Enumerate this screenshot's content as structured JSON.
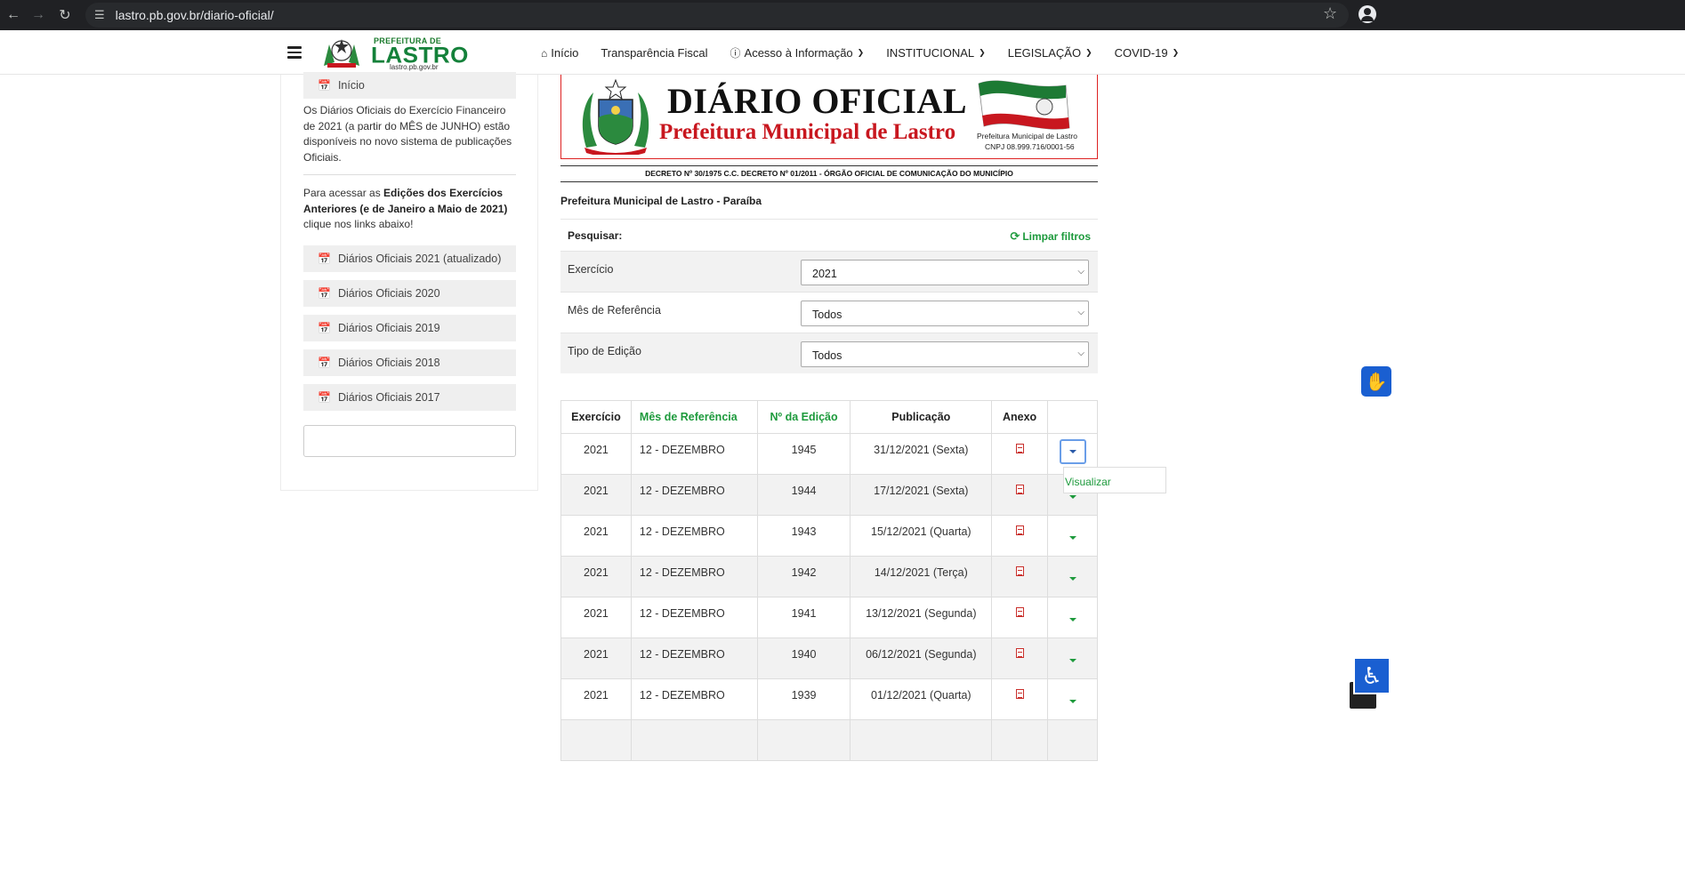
{
  "browser": {
    "url": "lastro.pb.gov.br/diario-oficial/"
  },
  "header": {
    "logo_prefix": "PREFEITURA DE",
    "logo_name": "LASTRO",
    "logo_url": "lastro.pb.gov.br",
    "nav": [
      {
        "label": "Início",
        "icon": "home-icon",
        "has_dropdown": false
      },
      {
        "label": "Transparência Fiscal",
        "icon": "",
        "has_dropdown": false
      },
      {
        "label": "Acesso à Informação",
        "icon": "info-icon",
        "has_dropdown": true
      },
      {
        "label": "INSTITUCIONAL",
        "icon": "",
        "has_dropdown": true
      },
      {
        "label": "LEGISLAÇÃO",
        "icon": "",
        "has_dropdown": true
      },
      {
        "label": "COVID-19",
        "icon": "",
        "has_dropdown": true
      }
    ]
  },
  "sidebar": {
    "home_button": "Início",
    "intro_text": "Os Diários Oficiais do Exercício Financeiro de 2021 (a partir do MÊS de JUNHO) estão disponíveis no novo sistema de publicações Oficiais.",
    "access_prefix": "Para acessar as ",
    "access_bold": "Edições dos Exercícios Anteriores (e de Janeiro a Maio de 2021)",
    "access_suffix": " clique nos links abaixo!",
    "links": [
      "Diários Oficiais 2021 (atualizado)",
      "Diários Oficiais 2020",
      "Diários Oficiais 2019",
      "Diários Oficiais 2018",
      "Diários Oficiais 2017"
    ]
  },
  "banner": {
    "title": "DIÁRIO OFICIAL",
    "subtitle": "Prefeitura Municipal de Lastro",
    "flag_caption": "Prefeitura Municipal de Lastro",
    "cnpj": "CNPJ 08.999.716/0001-56",
    "decree": "DECRETO Nº 30/1975 C.C. DECRETO Nº 01/2011 - ÓRGÃO OFICIAL DE COMUNICAÇÃO DO MUNICÍPIO"
  },
  "main": {
    "gov_name": "Prefeitura Municipal de Lastro - Paraíba",
    "search_label": "Pesquisar:",
    "clear_filters": "Limpar filtros",
    "filters": [
      {
        "label": "Exercício",
        "value": "2021"
      },
      {
        "label": "Mês de Referência",
        "value": "Todos"
      },
      {
        "label": "Tipo de Edição",
        "value": "Todos"
      }
    ]
  },
  "table": {
    "headers": {
      "exercicio": "Exercício",
      "mes": "Mês de Referência",
      "edicao": "Nº da Edição",
      "publicacao": "Publicação",
      "anexo": "Anexo"
    },
    "rows": [
      {
        "exercicio": "2021",
        "mes": "12 - DEZEMBRO",
        "edicao": "1945",
        "publicacao": "31/12/2021 (Sexta)"
      },
      {
        "exercicio": "2021",
        "mes": "12 - DEZEMBRO",
        "edicao": "1944",
        "publicacao": "17/12/2021 (Sexta)"
      },
      {
        "exercicio": "2021",
        "mes": "12 - DEZEMBRO",
        "edicao": "1943",
        "publicacao": "15/12/2021 (Quarta)"
      },
      {
        "exercicio": "2021",
        "mes": "12 - DEZEMBRO",
        "edicao": "1942",
        "publicacao": "14/12/2021 (Terça)"
      },
      {
        "exercicio": "2021",
        "mes": "12 - DEZEMBRO",
        "edicao": "1941",
        "publicacao": "13/12/2021 (Segunda)"
      },
      {
        "exercicio": "2021",
        "mes": "12 - DEZEMBRO",
        "edicao": "1940",
        "publicacao": "06/12/2021 (Segunda)"
      },
      {
        "exercicio": "2021",
        "mes": "12 - DEZEMBRO",
        "edicao": "1939",
        "publicacao": "01/12/2021 (Quarta)"
      }
    ],
    "dropdown_option": "Visualizar"
  },
  "colors": {
    "accent_green": "#1d9a3c",
    "banner_red": "#c8171f",
    "accessibility_blue": "#1a5fd1"
  }
}
